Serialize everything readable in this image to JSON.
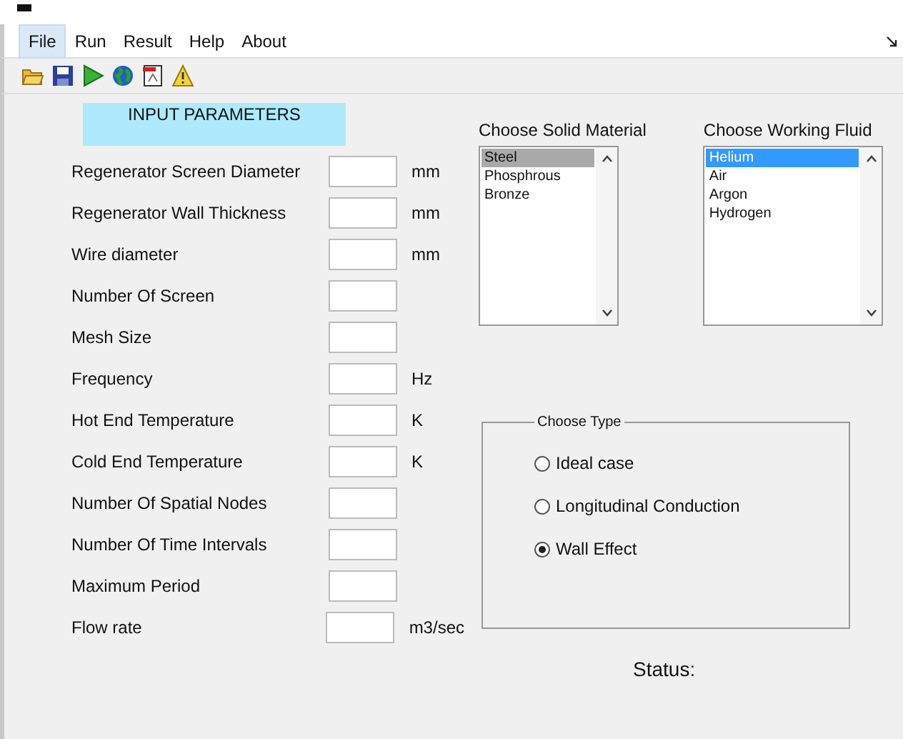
{
  "menu": [
    {
      "label": "File",
      "selected": true
    },
    {
      "label": "Run",
      "selected": false
    },
    {
      "label": "Result",
      "selected": false
    },
    {
      "label": "Help",
      "selected": false
    },
    {
      "label": "About",
      "selected": false
    }
  ],
  "header": "INPUT PARAMETERS",
  "fields": [
    {
      "label": "Regenerator Screen Diameter",
      "unit": "mm"
    },
    {
      "label": "Regenerator Wall Thickness",
      "unit": "mm"
    },
    {
      "label": "Wire diameter",
      "unit": "mm"
    },
    {
      "label": "Number Of Screen"
    },
    {
      "label": "Mesh Size"
    },
    {
      "label": "Frequency",
      "unit": "Hz"
    },
    {
      "label": "Hot End Temperature",
      "unit": "K"
    },
    {
      "label": "Cold  End Temperature",
      "unit": "K"
    },
    {
      "label": "Number Of Spatial Nodes"
    },
    {
      "label": "Number Of Time Intervals"
    },
    {
      "label": "Maximum Period"
    },
    {
      "label": "Flow rate",
      "unit": "m3/sec"
    }
  ],
  "lists": [
    {
      "title": "Choose Solid Material",
      "kind": "grey",
      "items": [
        {
          "label": "Steel",
          "selected": true
        },
        {
          "label": "Phosphrous Bronze",
          "selected": false
        }
      ]
    },
    {
      "title": "Choose Working Fluid",
      "kind": "blue",
      "items": [
        {
          "label": "Helium",
          "selected": true
        },
        {
          "label": "Air",
          "selected": false
        },
        {
          "label": "Argon",
          "selected": false
        },
        {
          "label": "Hydrogen",
          "selected": false
        }
      ]
    }
  ],
  "choose_type": {
    "title": "Choose Type",
    "options": [
      {
        "label": "Ideal case",
        "selected": false
      },
      {
        "label": "Longitudinal Conduction",
        "selected": false
      },
      {
        "label": "Wall Effect",
        "selected": true
      }
    ]
  },
  "status": "Status:"
}
